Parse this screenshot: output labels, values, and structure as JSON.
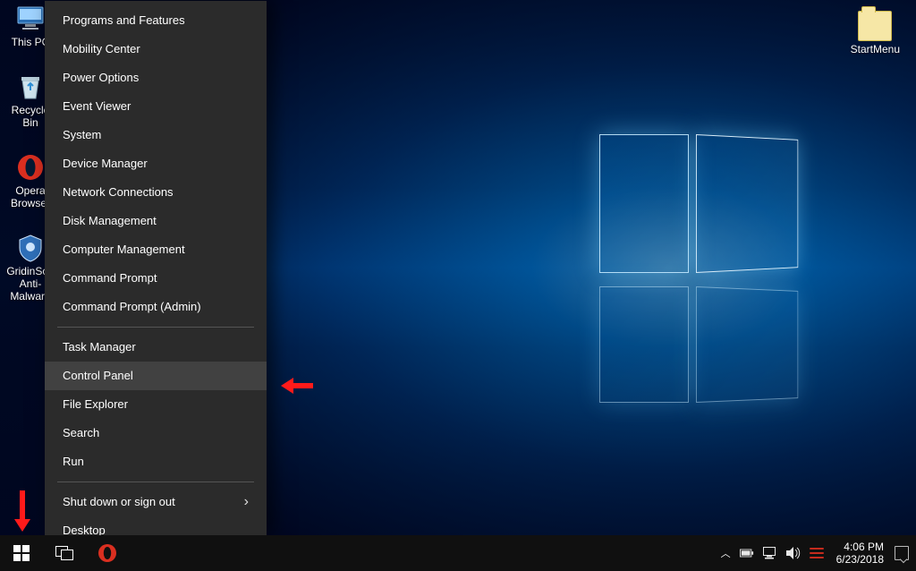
{
  "desktopIconsLeft": [
    {
      "label": "This PC",
      "icon": "pc"
    },
    {
      "label": "Recycle Bin",
      "icon": "recycle"
    },
    {
      "label": "Opera Browser",
      "icon": "opera"
    },
    {
      "label": "GridinSoft Anti-Malware",
      "icon": "shield"
    }
  ],
  "desktopIconRight": {
    "label": "StartMenu"
  },
  "winx": {
    "groups": [
      [
        "Programs and Features",
        "Mobility Center",
        "Power Options",
        "Event Viewer",
        "System",
        "Device Manager",
        "Network Connections",
        "Disk Management",
        "Computer Management",
        "Command Prompt",
        "Command Prompt (Admin)"
      ],
      [
        "Task Manager",
        "Control Panel",
        "File Explorer",
        "Search",
        "Run"
      ],
      [
        "Shut down or sign out",
        "Desktop"
      ]
    ],
    "hover": "Control Panel",
    "submenu": "Shut down or sign out"
  },
  "tray": {
    "time": "4:06 PM",
    "date": "6/23/2018"
  }
}
